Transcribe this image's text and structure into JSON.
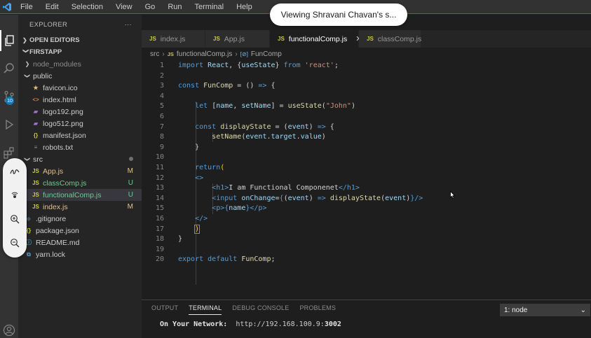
{
  "menu": [
    "File",
    "Edit",
    "Selection",
    "View",
    "Go",
    "Run",
    "Terminal",
    "Help"
  ],
  "share_banner": "Viewing Shravani Chavan's s...",
  "activity": {
    "scm_badge": "10"
  },
  "explorer": {
    "title": "EXPLORER",
    "more": "···",
    "open_editors": "OPEN EDITORS",
    "project": "FIRSTAPP",
    "items": [
      {
        "label": "node_modules",
        "kind": "folder-collapsed",
        "indent": 1,
        "status": ""
      },
      {
        "label": "public",
        "kind": "folder-open",
        "indent": 1,
        "status": ""
      },
      {
        "label": "favicon.ico",
        "kind": "ico",
        "indent": 2,
        "status": ""
      },
      {
        "label": "index.html",
        "kind": "html",
        "indent": 2,
        "status": ""
      },
      {
        "label": "logo192.png",
        "kind": "png",
        "indent": 2,
        "status": ""
      },
      {
        "label": "logo512.png",
        "kind": "png",
        "indent": 2,
        "status": ""
      },
      {
        "label": "manifest.json",
        "kind": "json",
        "indent": 2,
        "status": ""
      },
      {
        "label": "robots.txt",
        "kind": "txt",
        "indent": 2,
        "status": ""
      },
      {
        "label": "src",
        "kind": "folder-open",
        "indent": 1,
        "status": "dot"
      },
      {
        "label": "App.js",
        "kind": "js",
        "indent": 2,
        "status": "M"
      },
      {
        "label": "classComp.js",
        "kind": "js",
        "indent": 2,
        "status": "U"
      },
      {
        "label": "functionalComp.js",
        "kind": "js",
        "indent": 2,
        "status": "U",
        "selected": true
      },
      {
        "label": "index.js",
        "kind": "js",
        "indent": 2,
        "status": "M"
      },
      {
        "label": ".gitignore",
        "kind": "git",
        "indent": 1,
        "status": ""
      },
      {
        "label": "package.json",
        "kind": "json",
        "indent": 1,
        "status": ""
      },
      {
        "label": "README.md",
        "kind": "md",
        "indent": 1,
        "status": ""
      },
      {
        "label": "yarn.lock",
        "kind": "lock",
        "indent": 1,
        "status": ""
      }
    ]
  },
  "tabs": [
    {
      "label": "index.js",
      "active": false
    },
    {
      "label": "App.js",
      "active": false
    },
    {
      "label": "functionalComp.js",
      "active": true,
      "close": "✕"
    },
    {
      "label": "classComp.js",
      "active": false
    }
  ],
  "breadcrumb": {
    "folder": "src",
    "file": "functionalComp.js",
    "symbol": "FunComp"
  },
  "code": [
    [
      [
        "k",
        "import "
      ],
      [
        "v",
        "React"
      ],
      [
        "p",
        ", {"
      ],
      [
        "v",
        "useState"
      ],
      [
        "p",
        "} "
      ],
      [
        "k",
        "from "
      ],
      [
        "s",
        "'react'"
      ],
      [
        "p",
        ";"
      ]
    ],
    [],
    [
      [
        "k",
        "const "
      ],
      [
        "f",
        "FunComp"
      ],
      [
        "p",
        " = () "
      ],
      [
        "k",
        "=>"
      ],
      [
        "p",
        " {"
      ]
    ],
    [],
    [
      [
        "p",
        "    "
      ],
      [
        "k",
        "let "
      ],
      [
        "p",
        "["
      ],
      [
        "v",
        "name"
      ],
      [
        "p",
        ", "
      ],
      [
        "v",
        "setName"
      ],
      [
        "p",
        "] = "
      ],
      [
        "f",
        "useState"
      ],
      [
        "p",
        "("
      ],
      [
        "s",
        "\"John\""
      ],
      [
        "p",
        ")"
      ]
    ],
    [],
    [
      [
        "p",
        "    "
      ],
      [
        "k",
        "const "
      ],
      [
        "f",
        "displayState"
      ],
      [
        "p",
        " = ("
      ],
      [
        "v",
        "event"
      ],
      [
        "p",
        ") "
      ],
      [
        "k",
        "=>"
      ],
      [
        "p",
        " {"
      ]
    ],
    [
      [
        "p",
        "        "
      ],
      [
        "f",
        "setName"
      ],
      [
        "p",
        "("
      ],
      [
        "v",
        "event"
      ],
      [
        "p",
        "."
      ],
      [
        "v",
        "target"
      ],
      [
        "p",
        "."
      ],
      [
        "v",
        "value"
      ],
      [
        "p",
        ")"
      ]
    ],
    [
      [
        "p",
        "    }"
      ]
    ],
    [],
    [
      [
        "p",
        "    "
      ],
      [
        "k",
        "return"
      ],
      [
        "bk",
        "("
      ]
    ],
    [
      [
        "p",
        "    "
      ],
      [
        "t",
        "<>"
      ]
    ],
    [
      [
        "p",
        "        "
      ],
      [
        "t",
        "<h1>"
      ],
      [
        "p",
        "I am Functional Componenet"
      ],
      [
        "t",
        "</h1>"
      ]
    ],
    [
      [
        "p",
        "        "
      ],
      [
        "t",
        "<input "
      ],
      [
        "a",
        "onChange"
      ],
      [
        "p",
        "="
      ],
      [
        "k",
        "{"
      ],
      [
        "p",
        "("
      ],
      [
        "v",
        "event"
      ],
      [
        "p",
        ") "
      ],
      [
        "k",
        "=>"
      ],
      [
        "p",
        " "
      ],
      [
        "f",
        "displayState"
      ],
      [
        "p",
        "("
      ],
      [
        "v",
        "event"
      ],
      [
        "p",
        ")"
      ],
      [
        "k",
        "}"
      ],
      [
        "t",
        "/>"
      ]
    ],
    [
      [
        "p",
        "        "
      ],
      [
        "t",
        "<p>"
      ],
      [
        "k",
        "{"
      ],
      [
        "v",
        "name"
      ],
      [
        "k",
        "}"
      ],
      [
        "t",
        "</p>"
      ]
    ],
    [
      [
        "p",
        "    "
      ],
      [
        "t",
        "</>"
      ]
    ],
    [
      [
        "p",
        "    "
      ],
      [
        "bk",
        ")"
      ]
    ],
    [
      [
        "p",
        "}"
      ]
    ],
    [],
    [
      [
        "k",
        "export "
      ],
      [
        "k",
        "default "
      ],
      [
        "f",
        "FunComp"
      ],
      [
        "p",
        ";"
      ]
    ]
  ],
  "panel": {
    "tabs": [
      "OUTPUT",
      "TERMINAL",
      "DEBUG CONSOLE",
      "PROBLEMS"
    ],
    "active_tab": "TERMINAL",
    "terminal_select": "1: node",
    "terminal_label": "On Your Network:",
    "terminal_url_prefix": "http://192.168.100.9:",
    "terminal_port": "3002"
  },
  "colors": {
    "accent": "#007acc",
    "keyword": "#569cd6",
    "string": "#ce9178",
    "function": "#dcdcaa",
    "variable": "#9cdcfe",
    "modified": "#e2c08d",
    "untracked": "#73c991"
  }
}
